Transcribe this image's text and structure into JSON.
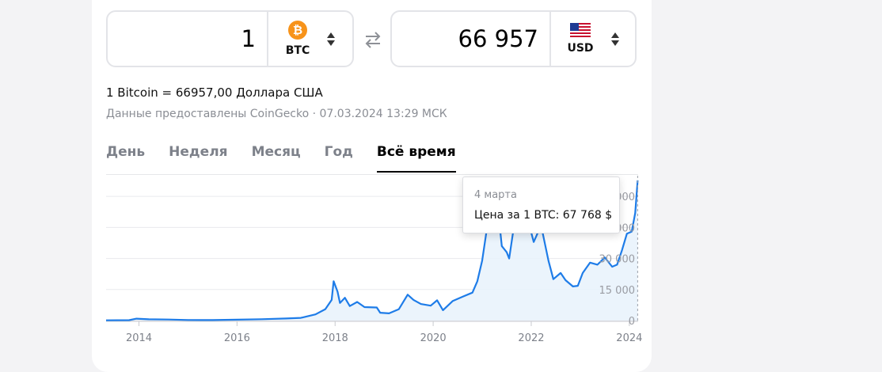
{
  "converter": {
    "from": {
      "amount": "1",
      "currency_code": "BTC",
      "icon": "bitcoin-icon",
      "icon_glyph": "₿"
    },
    "to": {
      "amount": "66 957",
      "currency_code": "USD",
      "icon": "us-flag-icon"
    },
    "swap_icon": "swap-arrows-icon"
  },
  "rate_text": "1 Bitcoin = 66957,00 Доллара США",
  "source_text": "Данные предоставлены CoinGecko · 07.03.2024 13:29 МСК",
  "tabs": [
    "День",
    "Неделя",
    "Месяц",
    "Год",
    "Всё время"
  ],
  "active_tab": "Всё время",
  "tooltip": {
    "date": "4 марта",
    "price": "Цена за 1 BTC: 67 768 $"
  },
  "colors": {
    "line": "#1e7ce8",
    "brand_btc": "#f7931a"
  },
  "chart_data": {
    "type": "area",
    "x_ticks": [
      "2014",
      "2016",
      "2018",
      "2020",
      "2022",
      "2024"
    ],
    "y_ticks": [
      "0",
      "15 000",
      "30 000",
      "45 000",
      "60 000"
    ],
    "ylim": [
      0,
      70000
    ],
    "xlim": [
      2013.33,
      2024.18
    ],
    "grid": true,
    "series": [
      {
        "points": [
          [
            2013.33,
            120
          ],
          [
            2013.8,
            200
          ],
          [
            2013.95,
            900
          ],
          [
            2014.2,
            600
          ],
          [
            2014.6,
            500
          ],
          [
            2015.0,
            260
          ],
          [
            2015.5,
            240
          ],
          [
            2016.0,
            430
          ],
          [
            2016.5,
            650
          ],
          [
            2017.0,
            1000
          ],
          [
            2017.3,
            1300
          ],
          [
            2017.6,
            3000
          ],
          [
            2017.8,
            5500
          ],
          [
            2017.93,
            10000
          ],
          [
            2017.97,
            19000
          ],
          [
            2018.05,
            14000
          ],
          [
            2018.1,
            8500
          ],
          [
            2018.2,
            11000
          ],
          [
            2018.3,
            7000
          ],
          [
            2018.45,
            9000
          ],
          [
            2018.6,
            6500
          ],
          [
            2018.85,
            6300
          ],
          [
            2018.92,
            3800
          ],
          [
            2019.1,
            3500
          ],
          [
            2019.3,
            5500
          ],
          [
            2019.48,
            12500
          ],
          [
            2019.6,
            10000
          ],
          [
            2019.75,
            8000
          ],
          [
            2019.95,
            7200
          ],
          [
            2020.08,
            9800
          ],
          [
            2020.2,
            5000
          ],
          [
            2020.4,
            9500
          ],
          [
            2020.6,
            11500
          ],
          [
            2020.8,
            13500
          ],
          [
            2020.9,
            19000
          ],
          [
            2021.0,
            29000
          ],
          [
            2021.1,
            45000
          ],
          [
            2021.2,
            57000
          ],
          [
            2021.28,
            63000
          ],
          [
            2021.4,
            36000
          ],
          [
            2021.5,
            33000
          ],
          [
            2021.55,
            30000
          ],
          [
            2021.65,
            46000
          ],
          [
            2021.75,
            44000
          ],
          [
            2021.85,
            65000
          ],
          [
            2021.95,
            47000
          ],
          [
            2022.05,
            38000
          ],
          [
            2022.2,
            46000
          ],
          [
            2022.35,
            29000
          ],
          [
            2022.45,
            20000
          ],
          [
            2022.6,
            23000
          ],
          [
            2022.7,
            19500
          ],
          [
            2022.85,
            16500
          ],
          [
            2022.95,
            16800
          ],
          [
            2023.05,
            23000
          ],
          [
            2023.2,
            28000
          ],
          [
            2023.35,
            27000
          ],
          [
            2023.5,
            30500
          ],
          [
            2023.65,
            26000
          ],
          [
            2023.75,
            27000
          ],
          [
            2023.85,
            34000
          ],
          [
            2023.95,
            42000
          ],
          [
            2024.05,
            43000
          ],
          [
            2024.12,
            52000
          ],
          [
            2024.17,
            67768
          ]
        ]
      }
    ]
  }
}
